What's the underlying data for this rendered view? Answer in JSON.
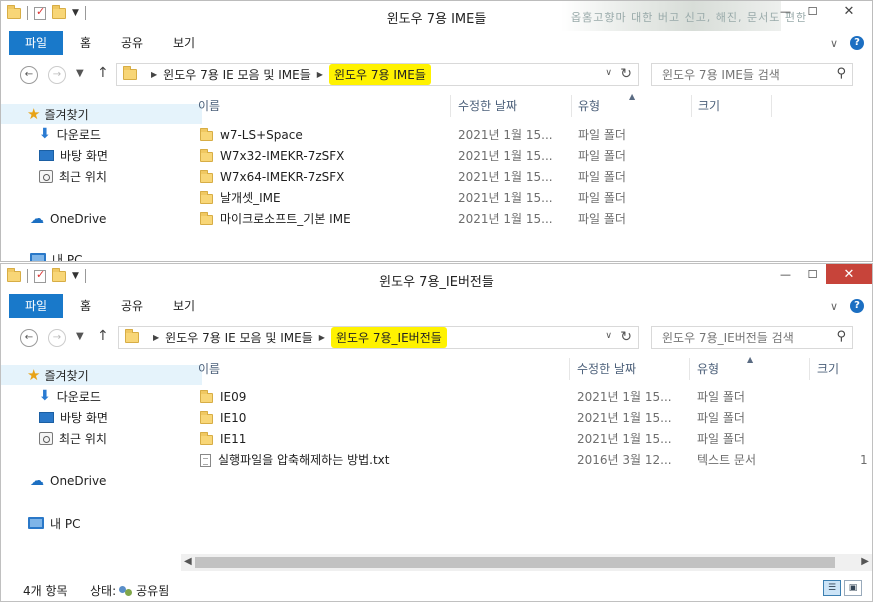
{
  "window_back": {
    "title": "윈도우 7용 IME들",
    "blurred_bg_text": "옵홈고향마 대한 버고 신고, 해진, 문서도 편한",
    "ribbon_tabs": [
      "파일",
      "홈",
      "공유",
      "보기"
    ],
    "breadcrumb": [
      "윈도우 7용 IE 모음 및 IME들",
      "윈도우 7용 IME들"
    ],
    "search_placeholder": "윈도우 7용 IME들 검색",
    "sidebar": {
      "favorites": "즐겨찾기",
      "downloads": "다운로드",
      "desktop": "바탕 화면",
      "recent": "최근 위치",
      "onedrive": "OneDrive",
      "thispc": "내 PC"
    },
    "columns": {
      "name": "이름",
      "date": "수정한 날짜",
      "type": "유형",
      "size": "크기"
    },
    "files": [
      {
        "name": "w7-LS+Space",
        "date": "2021년 1월 15...",
        "type": "파일 폴더"
      },
      {
        "name": "W7x32-IMEKR-7zSFX",
        "date": "2021년 1월 15...",
        "type": "파일 폴더"
      },
      {
        "name": "W7x64-IMEKR-7zSFX",
        "date": "2021년 1월 15...",
        "type": "파일 폴더"
      },
      {
        "name": "날개셋_IME",
        "date": "2021년 1월 15...",
        "type": "파일 폴더"
      },
      {
        "name": "마이크로소프트_기본 IME",
        "date": "2021년 1월 15...",
        "type": "파일 폴더"
      }
    ]
  },
  "window_front": {
    "title": "윈도우 7용_IE버전들",
    "ribbon_tabs": [
      "파일",
      "홈",
      "공유",
      "보기"
    ],
    "breadcrumb": [
      "윈도우 7용 IE 모음 및 IME들",
      "윈도우 7용_IE버전들"
    ],
    "search_placeholder": "윈도우 7용_IE버전들 검색",
    "sidebar": {
      "favorites": "즐겨찾기",
      "downloads": "다운로드",
      "desktop": "바탕 화면",
      "recent": "최근 위치",
      "onedrive": "OneDrive",
      "thispc": "내 PC"
    },
    "columns": {
      "name": "이름",
      "date": "수정한 날짜",
      "type": "유형",
      "size": "크기"
    },
    "files": [
      {
        "name": "IE09",
        "date": "2021년 1월 15...",
        "type": "파일 폴더",
        "size": "",
        "icon": "folder"
      },
      {
        "name": "IE10",
        "date": "2021년 1월 15...",
        "type": "파일 폴더",
        "size": "",
        "icon": "folder"
      },
      {
        "name": "IE11",
        "date": "2021년 1월 15...",
        "type": "파일 폴더",
        "size": "",
        "icon": "folder"
      },
      {
        "name": "실행파일을 압축해제하는 방법.txt",
        "date": "2016년 3월 12...",
        "type": "텍스트 문서",
        "size": "1",
        "icon": "text-file"
      }
    ],
    "status": {
      "count": "4개 항목",
      "state_label": "상태:",
      "state_value": "공유됨"
    }
  },
  "colors": {
    "file_tab": "#1979ca",
    "highlight": "#fff200",
    "close_button": "#c7443a",
    "selected_nav": "#e5f3fb"
  }
}
